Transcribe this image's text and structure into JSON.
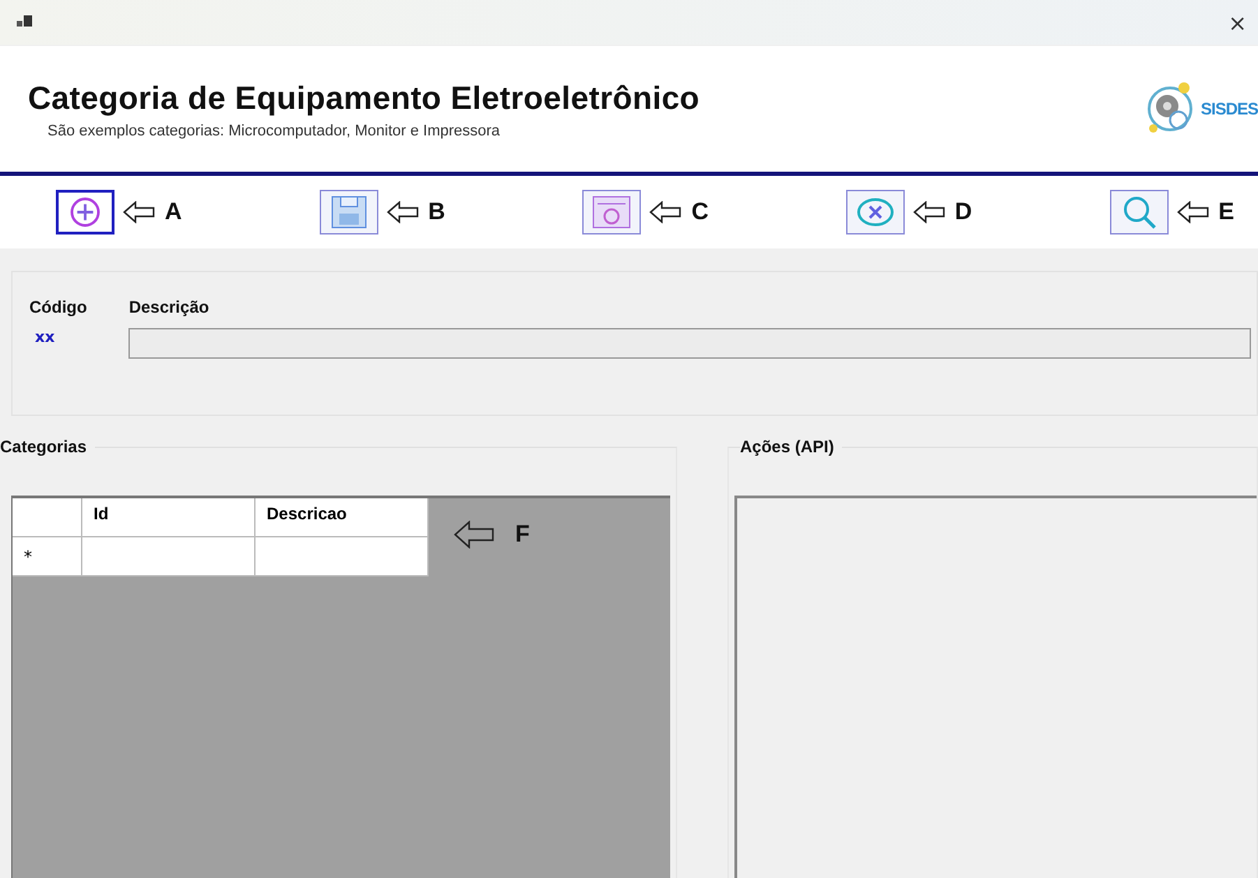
{
  "window": {
    "close": "×"
  },
  "header": {
    "title": "Categoria de Equipamento Eletroeletrônico",
    "subtitle": "São exemplos categorias: Microcomputador, Monitor e Impressora",
    "logo_text": "SISDES"
  },
  "toolbar": [
    {
      "kind": "add",
      "callout": "A",
      "selected": true
    },
    {
      "kind": "save",
      "callout": "B",
      "selected": false
    },
    {
      "kind": "camera",
      "callout": "C",
      "selected": false
    },
    {
      "kind": "cancel",
      "callout": "D",
      "selected": false
    },
    {
      "kind": "search",
      "callout": "E",
      "selected": false
    }
  ],
  "form": {
    "code_label": "Código",
    "code_value": "xx",
    "description_label": "Descrição"
  },
  "categories": {
    "title": "Categorias",
    "columns": [
      "Id",
      "Descricao"
    ],
    "new_row_marker": "*",
    "callout": "F"
  },
  "actions": {
    "title": "Ações (API)"
  }
}
